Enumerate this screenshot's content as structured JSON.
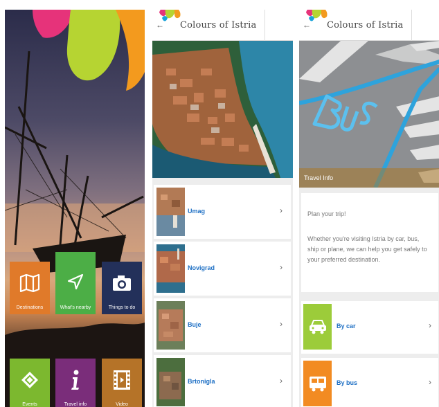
{
  "home": {
    "tiles": [
      {
        "label": "Destinations",
        "icon": "map-icon",
        "color": "#e07a2a"
      },
      {
        "label": "What's nearby",
        "icon": "location-arrow-icon",
        "color": "#4cae46"
      },
      {
        "label": "Things to do",
        "icon": "camera-icon",
        "color": "#23305a"
      },
      {
        "label": "Events",
        "icon": "ticket-icon",
        "color": "#7cb82f"
      },
      {
        "label": "Travel info",
        "icon": "info-icon",
        "color": "#7a2d7a"
      },
      {
        "label": "Video",
        "icon": "film-icon",
        "color": "#b57328"
      }
    ]
  },
  "header": {
    "title": "Colours of Istria",
    "back_glyph": "←"
  },
  "destinations": {
    "items": [
      {
        "name": "Umag"
      },
      {
        "name": "Novigrad"
      },
      {
        "name": "Buje"
      },
      {
        "name": "Brtonigla"
      }
    ],
    "chevron": "›"
  },
  "travel_info": {
    "hero_caption": "Travel Info",
    "heading": "Plan your trip!",
    "body": "Whether you're visiting Istria by car, bus, ship or plane, we can help you get safely to your preferred destination.",
    "options": [
      {
        "name": "By car",
        "color": "#9ccc3a",
        "icon": "car-icon"
      },
      {
        "name": "By bus",
        "color": "#f28b22",
        "icon": "bus-icon"
      }
    ],
    "chevron": "›"
  },
  "colors": {
    "link": "#1d6fc4",
    "logo_pink": "#e6337a",
    "logo_lime": "#b6d432",
    "logo_orange": "#f39a1e",
    "logo_blue": "#1aa3d9"
  }
}
